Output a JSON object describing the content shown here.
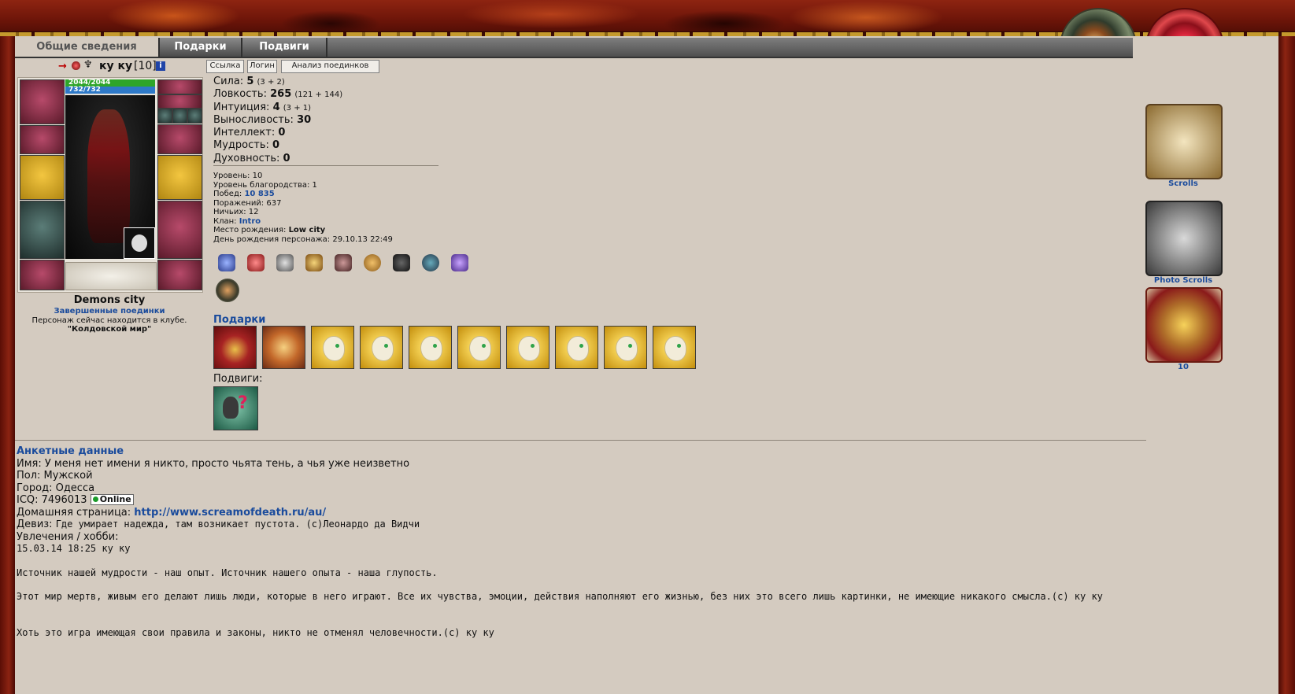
{
  "tabs": [
    "Общие сведения",
    "Подарки",
    "Подвиги"
  ],
  "character": {
    "name": "ку ку",
    "level": "[10]",
    "info_icon": "i",
    "hp": "2044/2044",
    "mana": "732/732",
    "city": "Demons city",
    "finished_battles_link": "Завершенные поединки",
    "location_line": "Персонаж сейчас находится в клубе.",
    "location_place": "\"Колдовской мир\""
  },
  "buttons": {
    "link": "Ссылка",
    "login": "Логин",
    "analysis": "Анализ поединков"
  },
  "stats": [
    {
      "label": "Сила:",
      "value": "5",
      "sub": "(3 + 2)"
    },
    {
      "label": "Ловкость:",
      "value": "265",
      "sub": "(121 + 144)"
    },
    {
      "label": "Интуиция:",
      "value": "4",
      "sub": "(3 + 1)"
    },
    {
      "label": "Выносливость:",
      "value": "30",
      "sub": ""
    },
    {
      "label": "Интеллект:",
      "value": "0",
      "sub": ""
    },
    {
      "label": "Мудрость:",
      "value": "0",
      "sub": ""
    },
    {
      "label": "Духовность:",
      "value": "0",
      "sub": ""
    }
  ],
  "details": {
    "level": "Уровень: 10",
    "nobility": "Уровень благородства: 1",
    "wins_label": "Побед:",
    "wins_value": "10 835",
    "losses": "Поражений: 637",
    "draws": "Ничьих: 12",
    "clan_label": "Клан:",
    "clan_value": "Intro",
    "birthplace_label": "Место рождения:",
    "birthplace_value": "Low city",
    "birthday": "День рождения персонажа: 29.10.13 22:49"
  },
  "gifts_title": "Подарки",
  "feats_title": "Подвиги:",
  "profile": {
    "title": "Анкетные данные",
    "name_line": "Имя: У меня нет имени я никто, просто чьята тень, а чья уже неизветно",
    "gender_line": "Пол: Мужской",
    "city_line": "Город: Одесса",
    "icq_label": "ICQ: 7496013",
    "online_badge": "Online",
    "homepage_label": "Домашняя страница:",
    "homepage_url": "http://www.screamofdeath.ru/au/",
    "motto_label": "Девиз:",
    "motto_text": "Где умирает надежда, там возникает пустота. (с)Леонардо да Видчи",
    "hobby_label": "Увлечения / хобби:",
    "hobby_date": "15.03.14 18:25 ку ку",
    "quote1": "Источник нашей мудрости - наш опыт. Источник нашего опыта - наша глупость.",
    "quote2": "Этот мир мертв, живым его делают лишь люди, которые в него играют. Все их чувства, эмоции, действия наполняют его жизнью, без них это всего лишь картинки, не имеющие никакого смысла.(с) ку ку",
    "quote3": "Хоть это игра имеющая свои правила и законы, никто не отменял человечности.(с) ку ку"
  },
  "right_column": {
    "scrolls": "Scrolls",
    "photo_scrolls": "Photo Scrolls",
    "count": "10"
  },
  "colors": {
    "link_blue": "#1a4b9c",
    "panel_bg": "#d4cbc0",
    "frame_red": "#6b1208"
  }
}
